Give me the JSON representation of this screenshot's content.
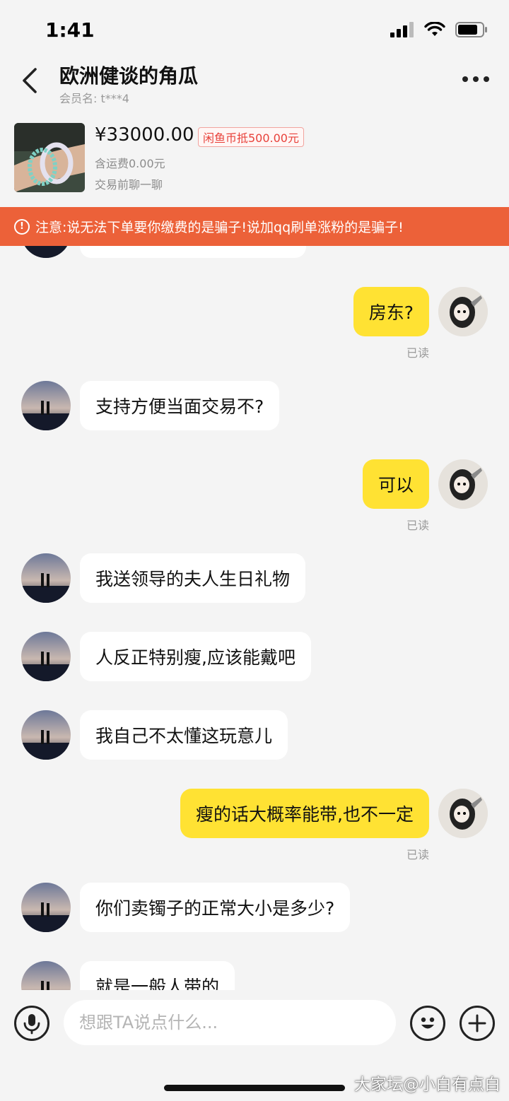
{
  "status_bar": {
    "time": "1:41"
  },
  "header": {
    "title": "欧洲健谈的角瓜",
    "member_label": "会员名:",
    "member_value": "t***4"
  },
  "product": {
    "price": "¥33000.00",
    "coin_badge": "闲鱼币抵500.00元",
    "shipping": "含运费0.00元",
    "chat_first": "交易前聊一聊"
  },
  "warning": {
    "icon": "!",
    "text": "注意:说无法下单要你缴费的是骗子!说加qq刷单涨粉的是骗子!"
  },
  "messages": [
    {
      "from": "me",
      "text": "房东?",
      "read": "已读"
    },
    {
      "from": "other",
      "text": "支持方便当面交易不?"
    },
    {
      "from": "me",
      "text": "可以",
      "read": "已读"
    },
    {
      "from": "other",
      "text": "我送领导的夫人生日礼物"
    },
    {
      "from": "other",
      "text": "人反正特别瘦,应该能戴吧"
    },
    {
      "from": "other",
      "text": "我自己不太懂这玩意儿"
    },
    {
      "from": "me",
      "text": "瘦的话大概率能带,也不一定",
      "read": "已读"
    },
    {
      "from": "other",
      "text": "你们卖镯子的正常大小是多少?"
    },
    {
      "from": "other",
      "text": "就是一般人带的"
    }
  ],
  "input": {
    "placeholder": "想跟TA说点什么..."
  },
  "watermark": "大家坛@小白有点白",
  "colors": {
    "warning_bg": "#ec6139",
    "my_bubble": "#ffe233",
    "other_bubble": "#ffffff",
    "badge_red": "#e8413a"
  },
  "icons": [
    "back-arrow-icon",
    "more-dots-icon",
    "warning-icon",
    "mic-icon",
    "emoji-icon",
    "plus-icon",
    "signal-icon",
    "wifi-icon",
    "battery-icon"
  ]
}
